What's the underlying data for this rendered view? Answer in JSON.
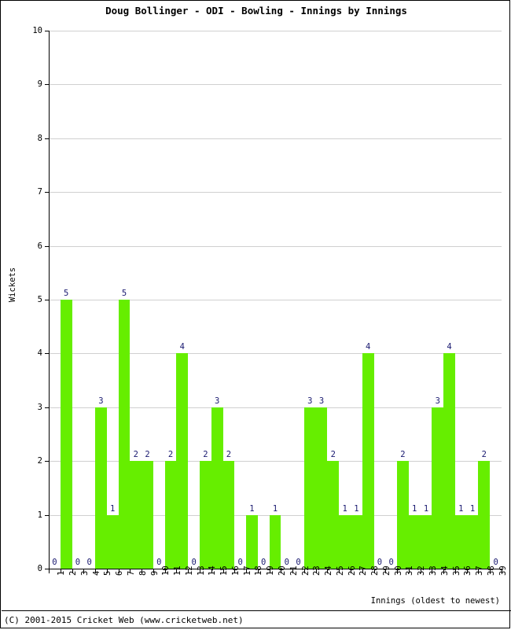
{
  "chart_data": {
    "type": "bar",
    "title": "Doug Bollinger - ODI - Bowling - Innings by Innings",
    "xlabel": "Innings (oldest to newest)",
    "ylabel": "Wickets",
    "ylim": [
      0,
      10
    ],
    "ytick_labels": [
      "0",
      "1",
      "2",
      "3",
      "4",
      "5",
      "6",
      "7",
      "8",
      "9",
      "10"
    ],
    "ytick_values": [
      0,
      1,
      2,
      3,
      4,
      5,
      6,
      7,
      8,
      9,
      10
    ],
    "grid": true,
    "legend": null,
    "bar_color": "#66ee00",
    "label_color": "#191970",
    "categories": [
      "1",
      "2",
      "3",
      "4",
      "5",
      "6",
      "7",
      "8",
      "9",
      "10",
      "11",
      "12",
      "13",
      "14",
      "15",
      "16",
      "17",
      "18",
      "19",
      "20",
      "21",
      "22",
      "23",
      "24",
      "25",
      "26",
      "27",
      "28",
      "29",
      "30",
      "31",
      "32",
      "33",
      "34",
      "35",
      "36",
      "37",
      "38",
      "39"
    ],
    "values": [
      0,
      5,
      0,
      0,
      3,
      1,
      5,
      2,
      2,
      0,
      2,
      4,
      0,
      2,
      3,
      2,
      0,
      1,
      0,
      1,
      0,
      0,
      3,
      3,
      2,
      1,
      1,
      4,
      0,
      0,
      2,
      1,
      1,
      3,
      4,
      1,
      1,
      2,
      0
    ]
  },
  "footer": {
    "copyright": "(C) 2001-2015 Cricket Web (www.cricketweb.net)"
  }
}
